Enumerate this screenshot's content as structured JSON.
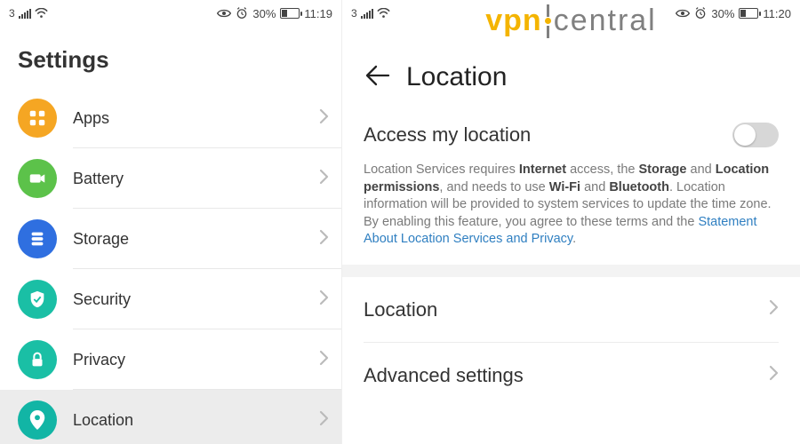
{
  "left": {
    "statusbar": {
      "carrier": "3",
      "battery_pct": "30%",
      "time": "11:19"
    },
    "page_title": "Settings",
    "items": [
      {
        "label": "Apps",
        "color": "#f5a623",
        "icon": "grid"
      },
      {
        "label": "Battery",
        "color": "#5cc24a",
        "icon": "video"
      },
      {
        "label": "Storage",
        "color": "#2f6fe0",
        "icon": "stack"
      },
      {
        "label": "Security",
        "color": "#1abfa5",
        "icon": "shield"
      },
      {
        "label": "Privacy",
        "color": "#1abfa5",
        "icon": "lock"
      },
      {
        "label": "Location",
        "color": "#12b5a5",
        "icon": "pin",
        "selected": true
      }
    ]
  },
  "right": {
    "statusbar": {
      "carrier": "3",
      "battery_pct": "30%",
      "time": "11:20"
    },
    "watermark_left": "vpn",
    "watermark_right": "central",
    "title": "Location",
    "access_label": "Access my location",
    "toggle_on": false,
    "desc_parts": {
      "t1": "Location Services requires ",
      "b1": "Internet",
      "t2": " access, the ",
      "b2": "Storage",
      "t3": " and ",
      "b3": "Location permissions",
      "t4": ", and needs to use ",
      "b4": "Wi-Fi",
      "t5": " and ",
      "b5": "Bluetooth",
      "t6": ". Location information will be provided to system services to update the time zone. By enabling this feature, you agree to these terms and the ",
      "link": "Statement About Location Services and Privacy",
      "t7": "."
    },
    "rows": [
      {
        "label": "Location"
      },
      {
        "label": "Advanced settings"
      }
    ]
  }
}
